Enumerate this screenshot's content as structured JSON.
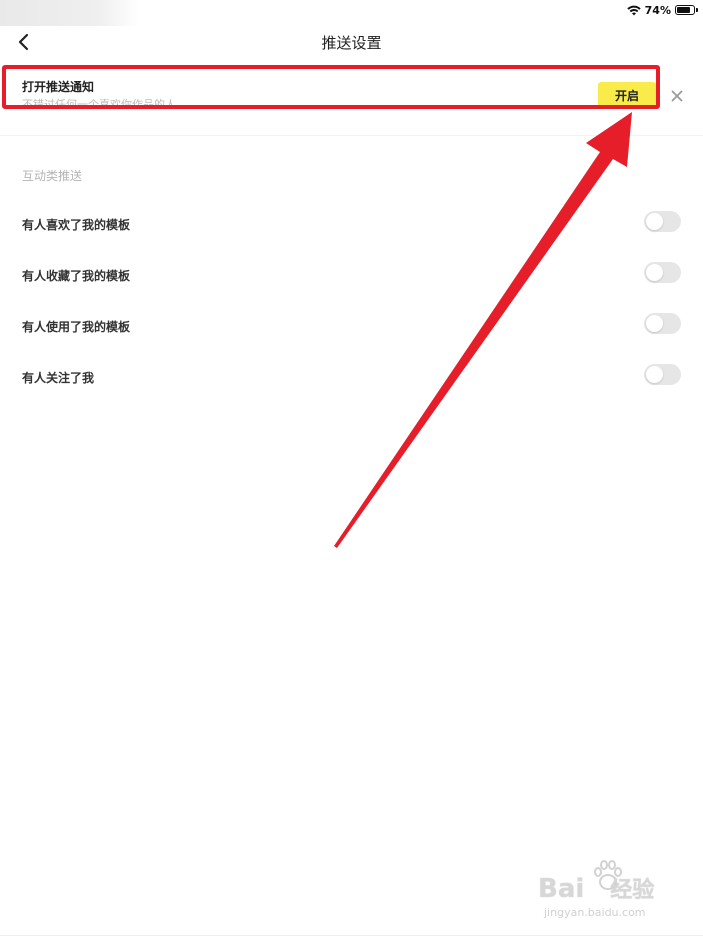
{
  "status_bar": {
    "battery_percent": "74%",
    "battery_level": 0.74
  },
  "nav": {
    "title": "推送设置"
  },
  "push_banner": {
    "title": "打开推送通知",
    "subtitle": "不错过任何一个喜欢你作品的人",
    "open_button_label": "开启"
  },
  "interaction_section": {
    "header": "互动类推送",
    "items": [
      {
        "label": "有人喜欢了我的模板",
        "enabled": false
      },
      {
        "label": "有人收藏了我的模板",
        "enabled": false
      },
      {
        "label": "有人使用了我的模板",
        "enabled": false
      },
      {
        "label": "有人关注了我",
        "enabled": false
      }
    ]
  },
  "watermark": {
    "logo": "Bai",
    "logo_suffix": "经验",
    "url": "jingyan.baidu.com"
  },
  "colors": {
    "accent_yellow": "#f9ec4a",
    "annotation_red": "#e61e2a",
    "toggle_off": "#e6e6e6"
  },
  "icons": {
    "back": "chevron-left-icon",
    "close": "close-icon",
    "wifi": "wifi-icon",
    "battery": "battery-icon"
  }
}
